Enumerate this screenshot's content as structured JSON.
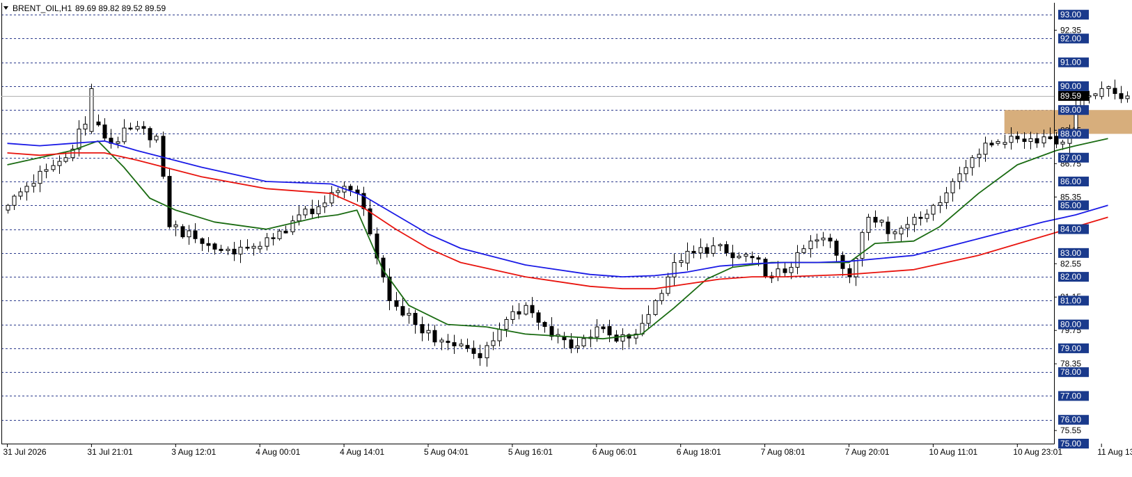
{
  "header": {
    "symbol_label": "BRENT_OIL,H1",
    "ohlc_label": "89.69 89.82 89.52 89.59"
  },
  "colors": {
    "background": "#ffffff",
    "grid": "#2b3a8c",
    "candle_up_body": "#ffffff",
    "candle_down_body": "#000000",
    "candle_outline": "#000000",
    "ma_fast": "#1a6b12",
    "ma_mid": "#e8140e",
    "ma_slow": "#1a1ae6",
    "zone_fill": "#d7ae7c",
    "price_tag_bg": "#1a3a8c",
    "current_tag_bg": "#000000",
    "axis_text": "#000000"
  },
  "chart_data": {
    "type": "candlestick",
    "symbol": "BRENT_OIL",
    "timeframe": "H1",
    "ylim": [
      75.0,
      93.5
    ],
    "y_major_labels": [
      "93.00",
      "92.00",
      "91.00",
      "90.00",
      "89.00",
      "88.00",
      "87.00",
      "86.00",
      "85.00",
      "84.00",
      "83.00",
      "82.00",
      "81.00",
      "80.00",
      "79.00",
      "78.00",
      "77.00",
      "76.00",
      "75.00"
    ],
    "y_major_values": [
      93,
      92,
      91,
      90,
      89,
      88,
      87,
      86,
      85,
      84,
      83,
      82,
      81,
      80,
      79,
      78,
      77,
      76,
      75
    ],
    "y_minor_labels": [
      "92.35",
      "88.15",
      "86.75",
      "85.35",
      "82.55",
      "81.15",
      "79.75",
      "78.35",
      "75.55"
    ],
    "y_minor_values": [
      92.35,
      88.15,
      86.75,
      85.35,
      82.55,
      81.15,
      79.75,
      78.35,
      75.55
    ],
    "current_price": 89.59,
    "current_price_label": "89.59",
    "x_labels": [
      "31 Jul 2026",
      "31 Jul 21:01",
      "3 Aug 12:01",
      "4 Aug 00:01",
      "4 Aug 14:01",
      "5 Aug 04:01",
      "5 Aug 16:01",
      "6 Aug 06:01",
      "6 Aug 18:01",
      "7 Aug 08:01",
      "7 Aug 20:01",
      "10 Aug 11:01",
      "10 Aug 23:01",
      "11 Aug 13:01"
    ],
    "x_label_bar_index": [
      0,
      13,
      26,
      39,
      52,
      65,
      78,
      91,
      104,
      117,
      130,
      143,
      156,
      169
    ],
    "total_bars": 174,
    "zone": {
      "from_bar": 154,
      "to_bar": 178,
      "low": 88.0,
      "high": 89.0
    },
    "anchors": [
      [
        0,
        85.0
      ],
      [
        3,
        85.8
      ],
      [
        6,
        86.5
      ],
      [
        9,
        87.0
      ],
      [
        11,
        88.2
      ],
      [
        13,
        88.5
      ],
      [
        16,
        87.6
      ],
      [
        19,
        88.2
      ],
      [
        23,
        87.9
      ],
      [
        25,
        84.1
      ],
      [
        29,
        83.6
      ],
      [
        33,
        83.1
      ],
      [
        37,
        83.2
      ],
      [
        41,
        83.6
      ],
      [
        45,
        84.6
      ],
      [
        49,
        85.1
      ],
      [
        52,
        85.8
      ],
      [
        54,
        85.5
      ],
      [
        56,
        83.8
      ],
      [
        59,
        81.0
      ],
      [
        63,
        80.0
      ],
      [
        67,
        79.3
      ],
      [
        71,
        79.0
      ],
      [
        73,
        78.6
      ],
      [
        76,
        79.8
      ],
      [
        80,
        80.8
      ],
      [
        84,
        79.5
      ],
      [
        88,
        79.1
      ],
      [
        91,
        79.9
      ],
      [
        94,
        79.3
      ],
      [
        97,
        79.6
      ],
      [
        100,
        81.0
      ],
      [
        103,
        82.6
      ],
      [
        106,
        83.0
      ],
      [
        109,
        83.3
      ],
      [
        112,
        82.8
      ],
      [
        115,
        82.8
      ],
      [
        118,
        82.0
      ],
      [
        121,
        82.4
      ],
      [
        124,
        83.5
      ],
      [
        127,
        83.5
      ],
      [
        130,
        82.0
      ],
      [
        133,
        84.5
      ],
      [
        135,
        84.3
      ],
      [
        137,
        83.8
      ],
      [
        140,
        84.5
      ],
      [
        143,
        85.0
      ],
      [
        146,
        86.0
      ],
      [
        149,
        87.0
      ],
      [
        152,
        87.6
      ],
      [
        155,
        87.9
      ],
      [
        158,
        87.8
      ],
      [
        161,
        87.9
      ],
      [
        163,
        87.6
      ],
      [
        165,
        89.1
      ],
      [
        167,
        89.6
      ],
      [
        169,
        89.9
      ],
      [
        171,
        89.69
      ],
      [
        173,
        89.59
      ]
    ],
    "special_bars": {
      "13": [
        88.1,
        90.1,
        88.0,
        89.9
      ]
    },
    "series": [
      {
        "name": "",
        "color_key": "ma_fast",
        "x": [
          0,
          5,
          10,
          14,
          18,
          22,
          26,
          32,
          40,
          48,
          51,
          54,
          58,
          62,
          68,
          74,
          80,
          86,
          92,
          98,
          103,
          108,
          112,
          118,
          124,
          130,
          134,
          140,
          144,
          150,
          156,
          162,
          165,
          170
        ],
        "y": [
          86.7,
          87.0,
          87.3,
          87.7,
          86.6,
          85.3,
          84.8,
          84.3,
          84.0,
          84.5,
          84.6,
          84.8,
          82.3,
          80.8,
          80.0,
          79.9,
          79.6,
          79.5,
          79.4,
          79.6,
          80.7,
          81.9,
          82.4,
          82.6,
          82.6,
          82.6,
          83.4,
          83.5,
          84.1,
          85.5,
          86.7,
          87.3,
          87.5,
          87.8
        ]
      },
      {
        "name": "",
        "color_key": "ma_mid",
        "x": [
          0,
          5,
          10,
          15,
          20,
          30,
          40,
          50,
          55,
          60,
          65,
          70,
          80,
          90,
          95,
          100,
          105,
          110,
          115,
          120,
          125,
          130,
          140,
          150,
          160,
          165,
          170
        ],
        "y": [
          87.2,
          87.1,
          87.2,
          87.2,
          86.9,
          86.2,
          85.7,
          85.5,
          84.9,
          84.0,
          83.2,
          82.6,
          82.0,
          81.6,
          81.5,
          81.5,
          81.7,
          81.9,
          82.0,
          82.0,
          82.05,
          82.1,
          82.3,
          82.9,
          83.7,
          84.1,
          84.5
        ]
      },
      {
        "name": "",
        "color_key": "ma_slow",
        "x": [
          0,
          5,
          10,
          15,
          20,
          30,
          40,
          50,
          55,
          60,
          65,
          70,
          80,
          90,
          95,
          100,
          105,
          110,
          115,
          120,
          125,
          130,
          140,
          150,
          160,
          165,
          170
        ],
        "y": [
          87.6,
          87.5,
          87.6,
          87.7,
          87.3,
          86.6,
          86.0,
          85.9,
          85.4,
          84.6,
          83.8,
          83.2,
          82.5,
          82.1,
          82.0,
          82.05,
          82.2,
          82.45,
          82.55,
          82.6,
          82.6,
          82.65,
          82.9,
          83.6,
          84.3,
          84.6,
          85.0
        ]
      }
    ]
  }
}
